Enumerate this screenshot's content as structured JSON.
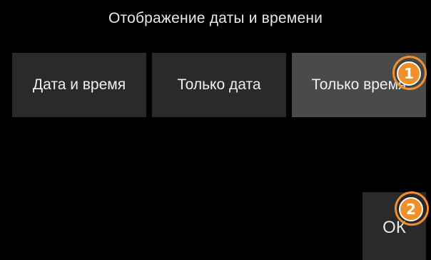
{
  "dialog": {
    "title": "Отображение даты и времени"
  },
  "options": [
    {
      "label": "Дата и время",
      "selected": false
    },
    {
      "label": "Только дата",
      "selected": false
    },
    {
      "label": "Только время",
      "selected": true
    }
  ],
  "ok_label": "ОК",
  "callouts": [
    "1",
    "2"
  ],
  "colors": {
    "background": "#000000",
    "button": "#2a2a2a",
    "button_selected": "#4a4a4a",
    "callout": "#f0902a"
  }
}
